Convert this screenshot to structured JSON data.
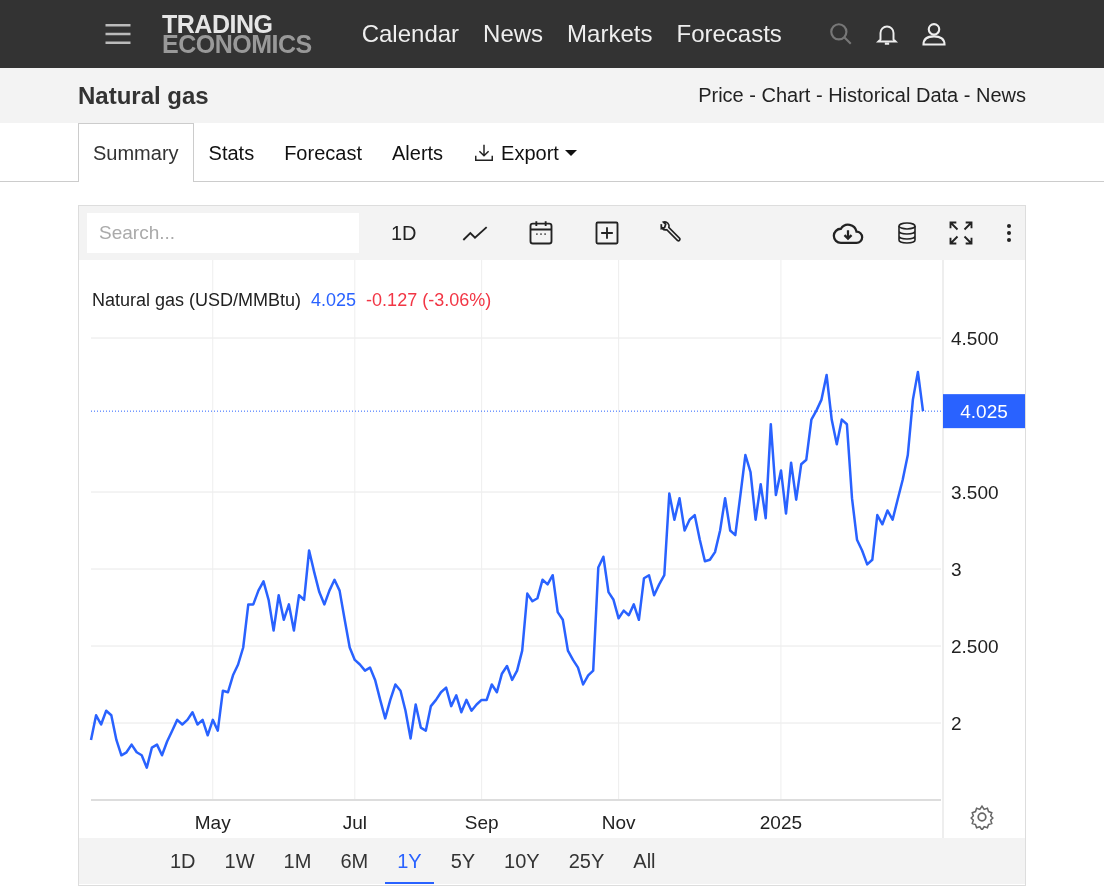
{
  "nav": {
    "logo_top": "TRADING",
    "logo_bottom": "ECONOMICS",
    "links": [
      "Calendar",
      "News",
      "Markets",
      "Forecasts"
    ]
  },
  "page": {
    "title": "Natural gas",
    "breadcrumb": "Price - Chart - Historical Data - News"
  },
  "tabs": [
    {
      "label": "Summary",
      "kind": "tab",
      "selected": true
    },
    {
      "label": "Stats",
      "kind": "tab",
      "selected": false
    },
    {
      "label": "Forecast",
      "kind": "tab",
      "selected": false
    },
    {
      "label": "Alerts",
      "kind": "tab",
      "selected": false
    },
    {
      "label": "Export",
      "kind": "dropdown",
      "selected": false
    }
  ],
  "toolbar": {
    "search_placeholder": "Search...",
    "interval": "1D"
  },
  "legend": {
    "last": "4.025",
    "change": "-0.127 (-3.06%)"
  },
  "chart_data": {
    "type": "line",
    "ylim": [
      1.5,
      5
    ],
    "categories": [
      null,
      null,
      null,
      null,
      null,
      null,
      null,
      null,
      null,
      null,
      null,
      null,
      null,
      null,
      null,
      null,
      null,
      null,
      null,
      null,
      null,
      null,
      null,
      null,
      "May",
      null,
      null,
      null,
      null,
      null,
      null,
      null,
      null,
      null,
      null,
      null,
      null,
      null,
      null,
      null,
      null,
      null,
      null,
      null,
      null,
      null,
      null,
      null,
      null,
      null,
      null,
      null,
      "Jul",
      null,
      null,
      null,
      null,
      null,
      null,
      null,
      null,
      null,
      null,
      null,
      null,
      null,
      null,
      null,
      null,
      null,
      null,
      null,
      null,
      null,
      null,
      null,
      null,
      "Sep",
      null,
      null,
      null,
      null,
      null,
      null,
      null,
      null,
      null,
      null,
      null,
      null,
      null,
      null,
      null,
      null,
      null,
      null,
      null,
      null,
      null,
      null,
      null,
      null,
      null,
      null,
      "Nov",
      null,
      null,
      null,
      null,
      null,
      null,
      null,
      null,
      null,
      null,
      null,
      null,
      null,
      null,
      null,
      null,
      null,
      null,
      null,
      null,
      null,
      null,
      null,
      null,
      null,
      null,
      null,
      null,
      null,
      null,
      null,
      "2025",
      null,
      null,
      null,
      null,
      null,
      null,
      null,
      null,
      null,
      null,
      null,
      null,
      null,
      null,
      null,
      null,
      null,
      null,
      null,
      null,
      null,
      null,
      null,
      null,
      null,
      null,
      null,
      null
    ],
    "yticks": [
      {
        "value": 2,
        "label": "2"
      },
      {
        "value": 2.5,
        "label": "2.500"
      },
      {
        "value": 3,
        "label": "3"
      },
      {
        "value": 3.5,
        "label": "3.500"
      },
      {
        "value": 4.5,
        "label": "4.500"
      }
    ],
    "grid": true,
    "ref_lines": [
      {
        "axis": "y",
        "value": 4.025,
        "label": "4.025",
        "color": "#2962ff"
      }
    ],
    "series": [
      {
        "name": "Natural gas (USD/MMBtu)",
        "color": "#2962ff",
        "values": [
          1.89,
          2.05,
          1.99,
          2.08,
          2.05,
          1.89,
          1.79,
          1.81,
          1.86,
          1.81,
          1.79,
          1.71,
          1.84,
          1.86,
          1.79,
          1.88,
          1.95,
          2.02,
          1.99,
          2.02,
          2.07,
          1.99,
          2.02,
          1.92,
          2.02,
          1.95,
          2.21,
          2.2,
          2.31,
          2.38,
          2.49,
          2.77,
          2.77,
          2.86,
          2.92,
          2.8,
          2.6,
          2.83,
          2.67,
          2.77,
          2.6,
          2.83,
          2.8,
          3.12,
          2.98,
          2.85,
          2.77,
          2.86,
          2.93,
          2.86,
          2.67,
          2.49,
          2.41,
          2.38,
          2.34,
          2.36,
          2.28,
          2.15,
          2.03,
          2.15,
          2.25,
          2.21,
          2.08,
          1.9,
          2.12,
          1.97,
          1.95,
          2.11,
          2.15,
          2.2,
          2.23,
          2.11,
          2.18,
          2.07,
          2.15,
          2.08,
          2.12,
          2.15,
          2.15,
          2.25,
          2.2,
          2.32,
          2.37,
          2.28,
          2.34,
          2.47,
          2.84,
          2.79,
          2.81,
          2.93,
          2.9,
          2.96,
          2.72,
          2.67,
          2.47,
          2.41,
          2.36,
          2.25,
          2.31,
          2.34,
          3.01,
          3.08,
          2.85,
          2.8,
          2.68,
          2.73,
          2.7,
          2.77,
          2.67,
          2.94,
          2.96,
          2.83,
          2.9,
          2.96,
          3.49,
          3.32,
          3.46,
          3.25,
          3.32,
          3.35,
          3.19,
          3.05,
          3.06,
          3.11,
          3.25,
          3.46,
          3.25,
          3.22,
          3.48,
          3.74,
          3.63,
          3.32,
          3.55,
          3.33,
          3.94,
          3.48,
          3.64,
          3.36,
          3.69,
          3.45,
          3.68,
          3.71,
          3.97,
          4.03,
          4.1,
          4.26,
          3.97,
          3.81,
          3.97,
          3.94,
          3.46,
          3.19,
          3.12,
          3.03,
          3.06,
          3.35,
          3.29,
          3.38,
          3.32,
          3.45,
          3.58,
          3.74,
          4.1,
          4.28,
          4.025
        ]
      }
    ]
  },
  "ranges": [
    {
      "label": "1D",
      "selected": false
    },
    {
      "label": "1W",
      "selected": false
    },
    {
      "label": "1M",
      "selected": false
    },
    {
      "label": "6M",
      "selected": false
    },
    {
      "label": "1Y",
      "selected": true
    },
    {
      "label": "5Y",
      "selected": false
    },
    {
      "label": "10Y",
      "selected": false
    },
    {
      "label": "25Y",
      "selected": false
    },
    {
      "label": "All",
      "selected": false
    }
  ]
}
